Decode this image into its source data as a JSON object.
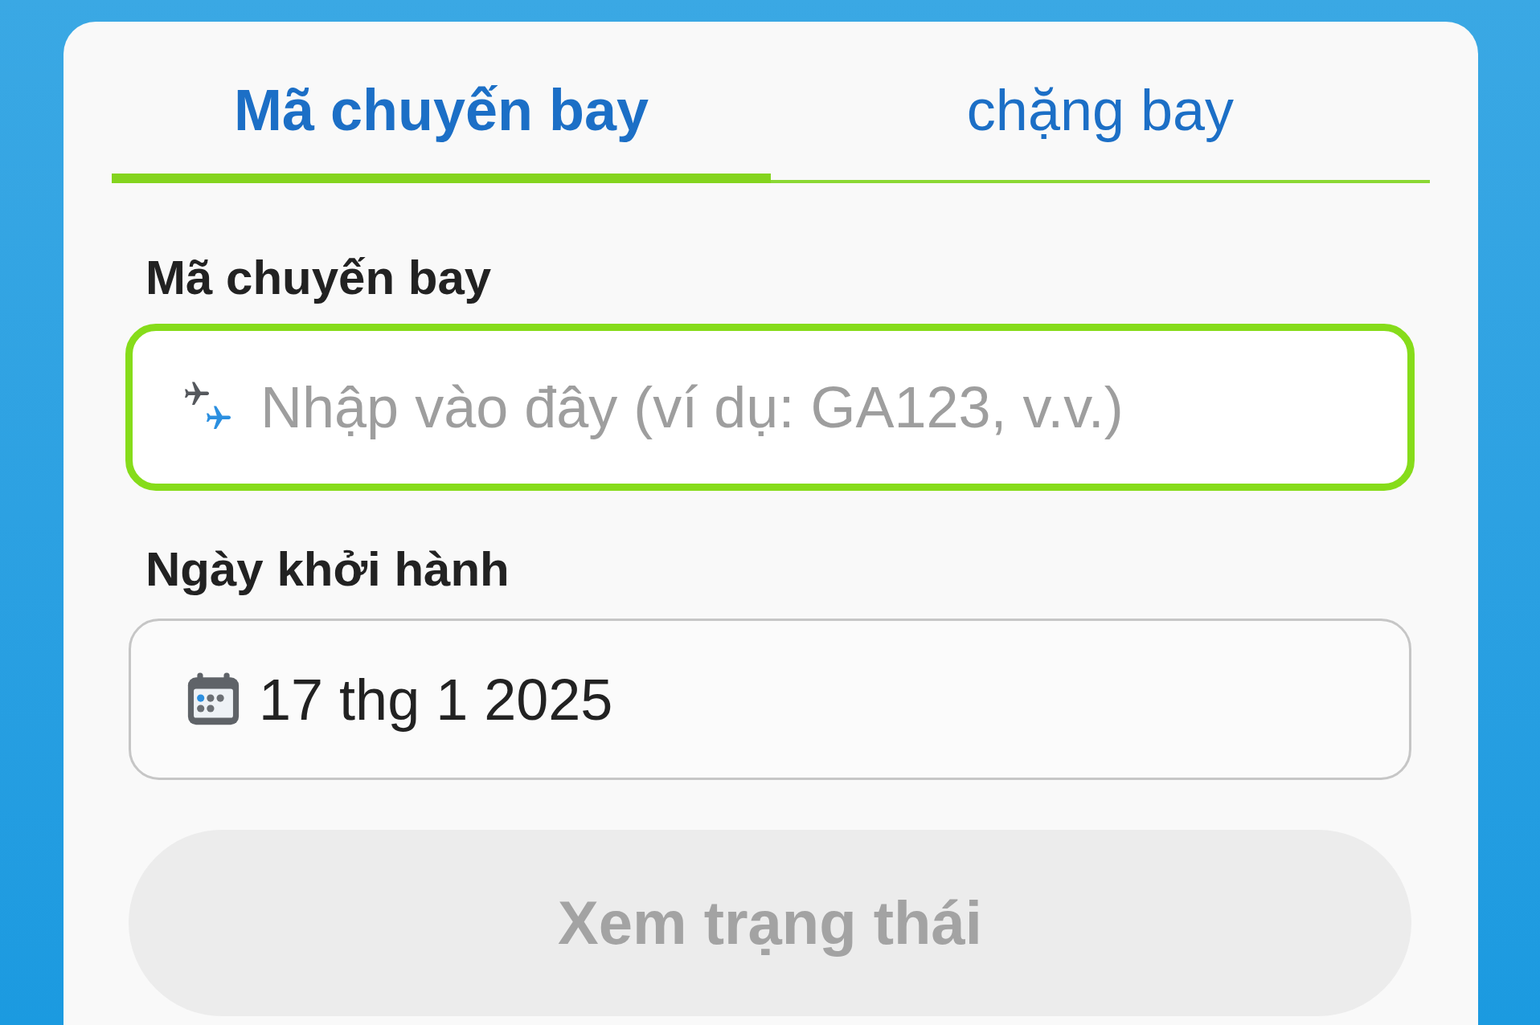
{
  "tabs": [
    {
      "label": "Mã chuyến bay",
      "selected": true
    },
    {
      "label": "chặng bay",
      "selected": false
    }
  ],
  "fields": [
    {
      "kind": "text",
      "label": "Mã chuyến bay",
      "placeholder": "Nhập vào đây (ví dụ: GA123, v.v.)",
      "focused": true
    },
    {
      "kind": "date",
      "label": "Ngày khởi hành",
      "value": "17 thg 1 2025",
      "focused": false
    }
  ],
  "submit_button": {
    "label": "Xem trạng thái",
    "disabled": true
  }
}
